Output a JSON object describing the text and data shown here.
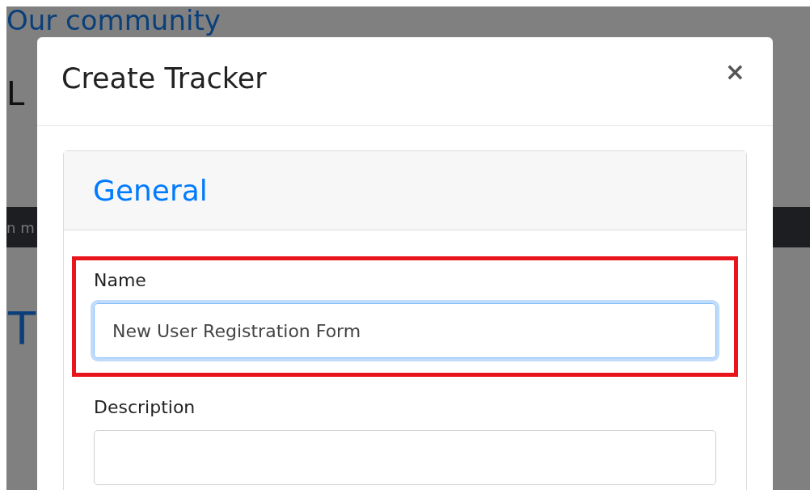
{
  "background_page": {
    "heading": "Our community",
    "subheading": "L",
    "nav_bar_text": "n m",
    "section_heading": "T"
  },
  "modal": {
    "title": "Create Tracker",
    "close": "×",
    "card": {
      "header": "General",
      "fields": [
        {
          "label": "Name",
          "value": "New User Registration Form",
          "focused": true,
          "highlighted": true
        },
        {
          "label": "Description",
          "focused": false,
          "highlighted": false
        }
      ]
    }
  }
}
